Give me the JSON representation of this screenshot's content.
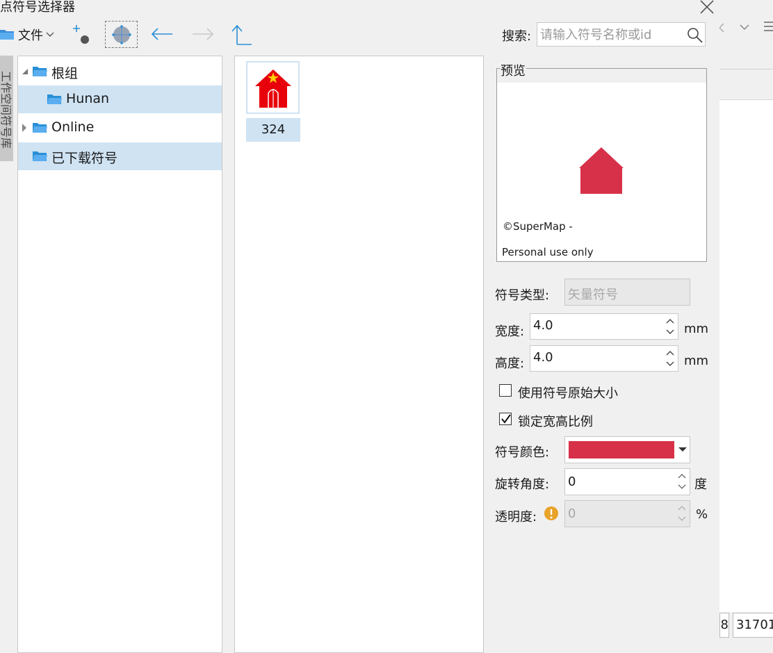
{
  "window": {
    "title": "点符号选择器"
  },
  "toolbar": {
    "file_label": "文件",
    "search_label": "搜索:",
    "search_placeholder": "请输入符号名称或id"
  },
  "side_tab": {
    "label": "工作空间符号库"
  },
  "tree": {
    "items": [
      {
        "label": "根组",
        "level": 0,
        "expander": "expanded",
        "selected": false
      },
      {
        "label": "Hunan",
        "level": 1,
        "expander": "none",
        "selected": true
      },
      {
        "label": "Online",
        "level": 0,
        "expander": "collapsed",
        "selected": false
      },
      {
        "label": "已下载符号",
        "level": 0,
        "expander": "none",
        "selected": true
      }
    ]
  },
  "symbols": [
    {
      "id": "324",
      "icon": "red-house-with-star-icon"
    }
  ],
  "preview": {
    "legend": "预览",
    "watermark_line1": "©SuperMap -",
    "watermark_line2": "Personal use only",
    "symbol_color": "#d7314a"
  },
  "props": {
    "type_label": "符号类型:",
    "type_value": "矢量符号",
    "width_label": "宽度:",
    "width_value": "4.0",
    "width_unit": "mm",
    "height_label": "高度:",
    "height_value": "4.0",
    "height_unit": "mm",
    "original_size_label": "使用符号原始大小",
    "original_size_checked": false,
    "lock_ratio_label": "锁定宽高比例",
    "lock_ratio_checked": true,
    "color_label": "符号颜色:",
    "color_value": "#d7314a",
    "rotation_label": "旋转角度:",
    "rotation_value": "0",
    "rotation_unit": "度",
    "transparency_label": "透明度:",
    "transparency_value": "0",
    "transparency_unit": "%"
  },
  "background": {
    "coord_a": "8",
    "coord_b": "31701"
  }
}
